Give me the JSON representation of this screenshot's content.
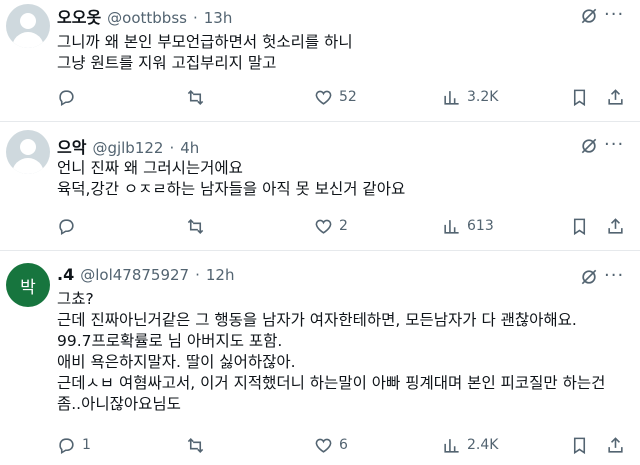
{
  "tweets": [
    {
      "avatar": "default-avatar",
      "name": "오오옷",
      "handle": "@oottbbss",
      "separator": "·",
      "time": "13h",
      "lines": [
        "그니까 왜 본인 부모언급하면서 헛소리를 하니",
        "그냥 원트를 지워 고집부리지 말고"
      ],
      "replies": "",
      "retweets": "",
      "likes": "52",
      "views": "3.2K"
    },
    {
      "avatar": "default-avatar",
      "name": "으악",
      "handle": "@gjlb122",
      "separator": "·",
      "time": "4h",
      "lines": [
        "언니 진짜 왜 그러시는거에요",
        "육덕,강간 ㅇㅈㄹ하는 남자들을 아직 못 보신거 같아요"
      ],
      "replies": "",
      "retweets": "",
      "likes": "2",
      "views": "613"
    },
    {
      "avatar": "박",
      "name": ".4",
      "handle": "@lol47875927",
      "separator": "·",
      "time": "12h",
      "lines": [
        "그쵸?",
        "근데 진짜아닌거같은 그 행동을 남자가 여자한테하면, 모든남자가 다 괜찮아해요.",
        "99.7프로확률로 님 아버지도 포함.",
        "애비 욕은하지말자. 딸이 싫어하잖아.",
        "근데ㅅㅂ 여혐싸고서, 이거 지적했더니 하는말이 아빠 핑계대며 본인 피코질만 하는건",
        "좀..아니잖아요님도"
      ],
      "replies": "1",
      "retweets": "",
      "likes": "6",
      "views": "2.4K"
    }
  ],
  "icons": {
    "reply": "reply-icon",
    "retweet": "retweet-icon",
    "like": "heart-icon",
    "views": "views-icon",
    "bookmark": "bookmark-icon",
    "share": "share-icon",
    "grok": "grok-icon",
    "more": "more-icon"
  },
  "colors": {
    "text": "#0f1419",
    "secondary": "#536471",
    "divider": "#e6e9ec",
    "avatar_default": "#cfd9de",
    "avatar_green": "#17753e"
  }
}
